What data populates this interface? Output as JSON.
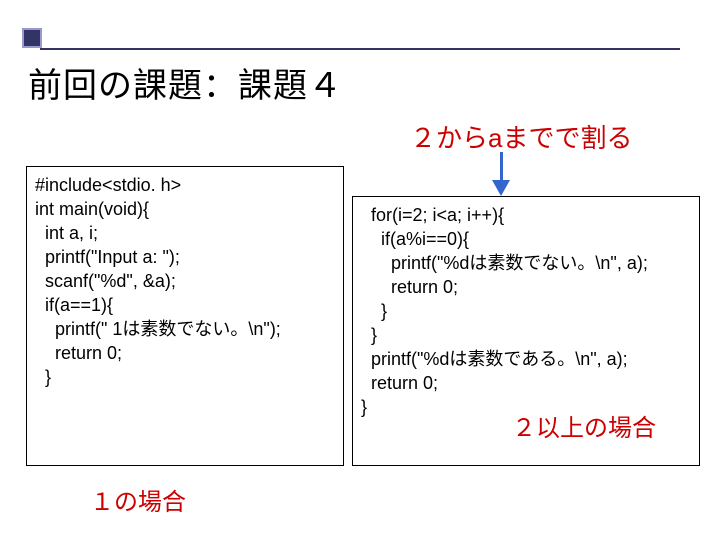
{
  "title": "前回の課題：課題４",
  "subtitle": "２からaまでで割る",
  "code_left": {
    "l1": "#include<stdio. h>",
    "l2": "",
    "l3": "int main(void){",
    "l4": "  int a, i;",
    "l5": "",
    "l6": "  printf(\"Input a: \");",
    "l7": "  scanf(\"%d\", &a);",
    "l8": "  if(a==1){",
    "l9": "    printf(\" 1は素数でない。\\n\");",
    "l10": "    return 0;",
    "l11": "  }"
  },
  "code_right": {
    "l1": "  for(i=2; i<a; i++){",
    "l2": "    if(a%i==0){",
    "l3": "      printf(\"%dは素数でない。\\n\", a);",
    "l4": "      return 0;",
    "l5": "    }",
    "l6": "  }",
    "l7": "  printf(\"%dは素数である。\\n\", a);",
    "l8": "  return 0;",
    "l9": "}"
  },
  "caption_left": "１の場合",
  "caption_right": "２以上の場合"
}
